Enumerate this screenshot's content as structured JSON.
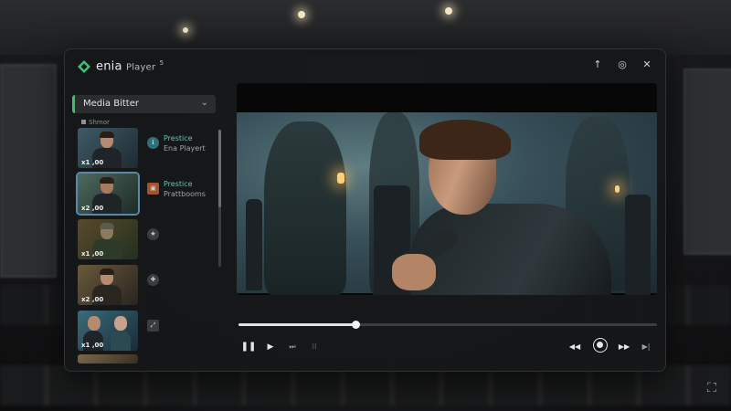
{
  "app": {
    "name": "enia",
    "name_suffix": "Player",
    "name_mark": "5",
    "accent": "#3fbf6f"
  },
  "window_controls": [
    {
      "name": "minimize-icon",
      "glyph": "↑"
    },
    {
      "name": "settings-icon",
      "glyph": "◎"
    },
    {
      "name": "close-icon",
      "glyph": "✕"
    }
  ],
  "sidebar": {
    "dropdown": {
      "selected": "Media Bitter",
      "icon": "chevron-down-icon"
    },
    "section": "Shmor",
    "items": [
      {
        "duration": "x1 ,00",
        "icon": "info-icon",
        "icon_glyph": "ℹ",
        "title": "Prestice",
        "subtitle": "Ena Playert"
      },
      {
        "duration": "x2 ,00",
        "icon": "film-icon",
        "icon_glyph": "▣",
        "title": "Prestice",
        "subtitle": "Prattbooms",
        "selected": true
      },
      {
        "duration": "x1 ,00",
        "icon": "star-icon",
        "icon_glyph": "★"
      },
      {
        "duration": "x2 ,00",
        "icon": "plus-icon",
        "icon_glyph": "✚"
      },
      {
        "duration": "x1 ,00",
        "icon": "expand-icon",
        "icon_glyph": "⤢"
      },
      {
        "duration": "",
        "icon": ""
      }
    ]
  },
  "player": {
    "progress": 0.28,
    "indicator": "● ● ◦"
  },
  "controls": {
    "left": [
      {
        "name": "pause-icon",
        "glyph": "❚❚"
      },
      {
        "name": "next-frame-icon",
        "glyph": "▶"
      },
      {
        "name": "skip-forward-icon",
        "glyph": "⏭"
      },
      {
        "name": "captions-icon",
        "glyph": "⁝⁝"
      }
    ],
    "right": [
      {
        "name": "rewind-icon",
        "glyph": "◀◀"
      },
      {
        "name": "stop-icon",
        "glyph": ""
      },
      {
        "name": "fast-forward-icon",
        "glyph": "▶▶"
      },
      {
        "name": "skip-end-icon",
        "glyph": "▶|"
      }
    ]
  },
  "corner": {
    "icon": "fullscreen-icon",
    "glyph": "⛶"
  }
}
